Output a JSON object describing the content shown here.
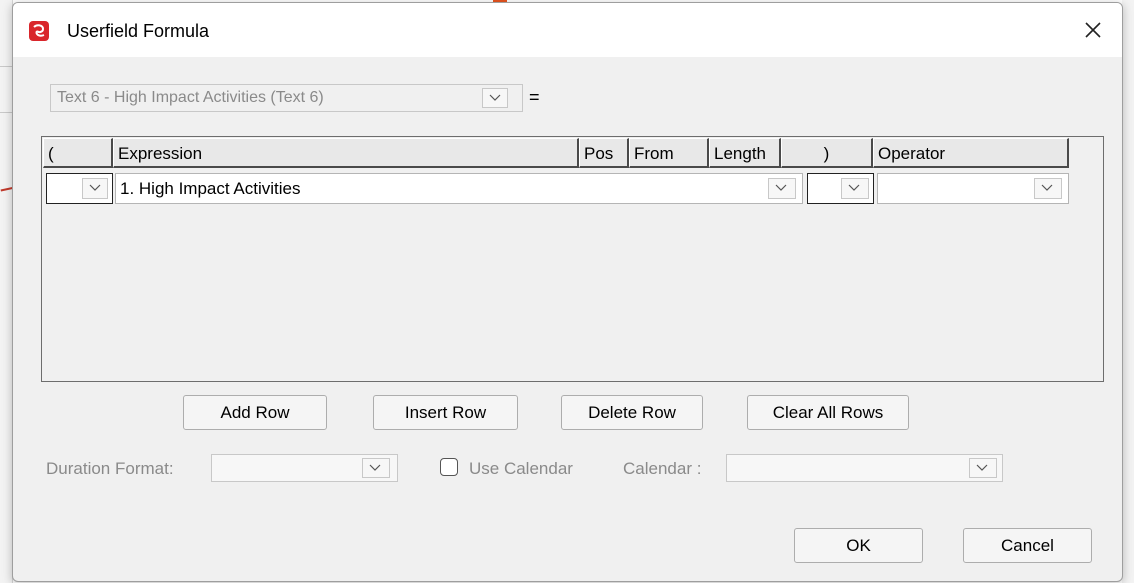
{
  "dialog": {
    "title": "Userfield Formula",
    "close_glyph": "✕"
  },
  "target_field": {
    "value": "Text 6 - High Impact Activities (Text 6)",
    "equals": "="
  },
  "grid": {
    "columns": [
      "(",
      "Expression",
      "Pos",
      "From",
      "Length",
      ")",
      "Operator"
    ],
    "rows": [
      {
        "open_paren": "",
        "expression": "1. High Impact Activities",
        "close_paren": "",
        "operator": ""
      }
    ]
  },
  "buttons": {
    "add_row": "Add Row",
    "insert_row": "Insert Row",
    "delete_row": "Delete Row",
    "clear_all_rows": "Clear All Rows",
    "ok": "OK",
    "cancel": "Cancel"
  },
  "options": {
    "duration_format_label": "Duration Format:",
    "duration_format_value": "",
    "use_calendar_label": "Use Calendar",
    "use_calendar_checked": false,
    "calendar_label": "Calendar :",
    "calendar_value": ""
  },
  "colors": {
    "app_icon": "#d9262b",
    "annotation_arrow": "#c0392b",
    "disabled_text": "#8a8a8a"
  },
  "icons": {
    "app": "app-logo-icon",
    "close": "close-icon",
    "dropdown": "chevron-down-icon"
  }
}
